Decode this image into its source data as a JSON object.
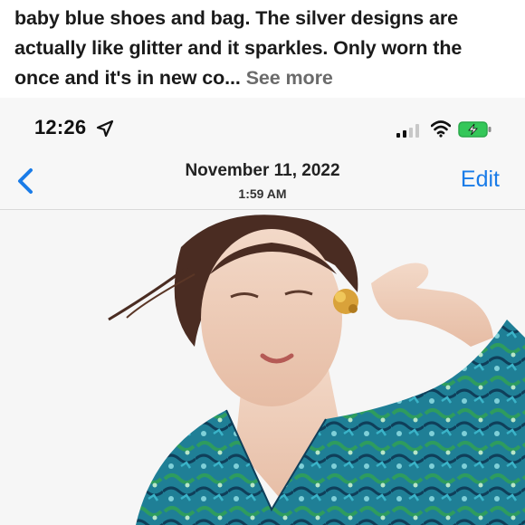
{
  "listing": {
    "caption": "baby blue shoes and bag. The silver designs are actually like glitter and it sparkles. Only worn the once and it's in new co...",
    "see_more": "See more"
  },
  "status_bar": {
    "time": "12:26",
    "icons": [
      "location-arrow-icon",
      "signal-icon",
      "wifi-icon",
      "battery-charging-icon"
    ]
  },
  "photo_viewer": {
    "date": "November 11, 2022",
    "time": "1:59 AM",
    "edit_label": "Edit",
    "back_icon": "chevron-left-icon"
  },
  "colors": {
    "accent": "#1a7ce8",
    "battery": "#34c759",
    "dress_primary": "#1f8aa0",
    "dress_secondary": "#2e9c5e"
  }
}
